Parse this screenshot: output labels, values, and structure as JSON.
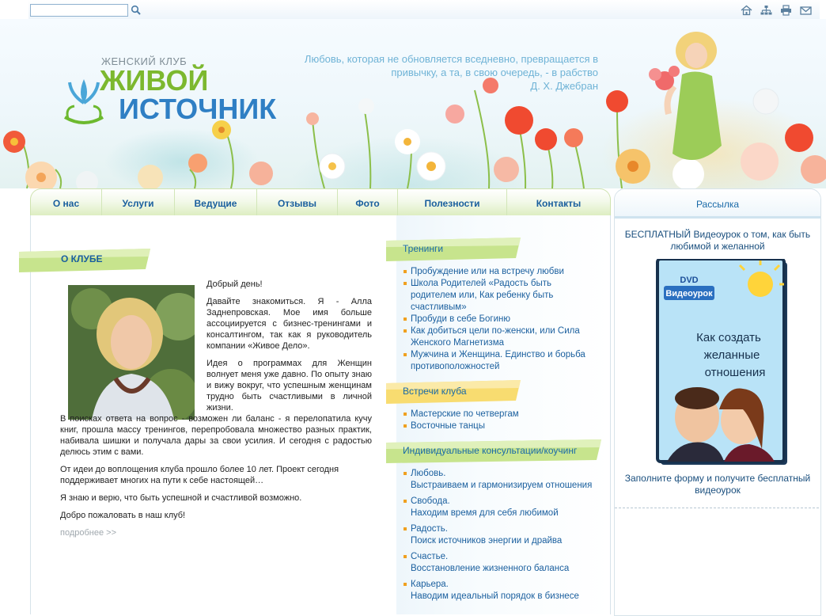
{
  "search": {
    "placeholder": ""
  },
  "toolbar": {
    "icons": [
      "home-icon",
      "sitemap-icon",
      "print-icon",
      "mail-icon"
    ]
  },
  "header": {
    "logo_small": "ЖЕНСКИЙ КЛУБ",
    "logo_line1": "ЖИВОЙ",
    "logo_line2": "ИСТОЧНИК",
    "quote_lines": [
      "Любовь, которая не обновляется вседневно, превращается в",
      "привычку, а та, в свою очередь, - в рабство"
    ],
    "quote_author": "Д. Х. Джебран"
  },
  "nav": {
    "items": [
      "О нас",
      "Услуги",
      "Ведущие",
      "Отзывы",
      "Фото",
      "Полезности",
      "Контакты"
    ]
  },
  "about": {
    "title": "О КЛУБЕ",
    "p1": "Добрый день!",
    "p2": "Давайте знакомиться. Я - Алла Заднепровская. Мое имя больше ассоциируется с бизнес-тренингами и консалтингом, так как я руководитель компании «Живое Дело».",
    "p3a": "Идея о программах для Женщин волнует меня уже давно. По опыту знаю и вижу вокруг, что успешным женщинам трудно быть счастливыми в личной жизни.",
    "p3b": "В поисках ответа на вопрос - возможен ли баланс - я перелопатила кучу книг, прошла массу тренингов, перепробовала множество разных практик, набивала шишки и получала дары за свои усилия. И сегодня с радостью делюсь этим с вами.",
    "p4": "От идеи до воплощения клуба прошло более 10 лет. Проект сегодня поддерживает многих на пути к себе настоящей…",
    "p5": "Я знаю и верю, что быть успешной и счастливой возможно.",
    "p6": "Добро пожаловать в наш клуб!",
    "more": "подробнее >>"
  },
  "trainings": {
    "title": "Тренинги",
    "items": [
      "Пробуждение или на встречу любви",
      "Школа Родителей «Радость быть родителем или, Как ребенку быть счастливым»",
      "Пробуди в себе Богиню",
      "Как добиться цели по-женски, или Сила Женского Магнетизма",
      "Мужчина и Женщина. Единство и борьба противоположностей"
    ]
  },
  "meetings": {
    "title": "Встречи клуба",
    "items": [
      "Мастерские по четвергам",
      "Восточные танцы"
    ]
  },
  "coaching": {
    "title": "Индивидуальные консультации/коучинг",
    "items": [
      {
        "head": "Любовь.",
        "sub": "Выстраиваем и гармонизируем отношения"
      },
      {
        "head": "Свобода.",
        "sub": "Находим время для себя любимой"
      },
      {
        "head": "Радость.",
        "sub": "Поиск источников энергии и драйва"
      },
      {
        "head": "Счастье.",
        "sub": "Восстановление жизненного баланса"
      },
      {
        "head": "Карьера.",
        "sub": "Наводим идеальный порядок в бизнесе"
      }
    ]
  },
  "sidebar": {
    "title": "Рассылка",
    "promo": "БЕСПЛАТНЫЙ Видеоурок о том, как быть любимой и желанной",
    "dvd_label": "Видеоурок",
    "dvd_text": [
      "Как создать",
      "желанные",
      "отношения"
    ],
    "cta": "Заполните форму и получите бесплатный видеоурок"
  },
  "colors": {
    "link": "#1a5f9e",
    "accent_green": "#7cb82f",
    "accent_blue": "#2f7fc4",
    "bullet": "#f0a020"
  }
}
